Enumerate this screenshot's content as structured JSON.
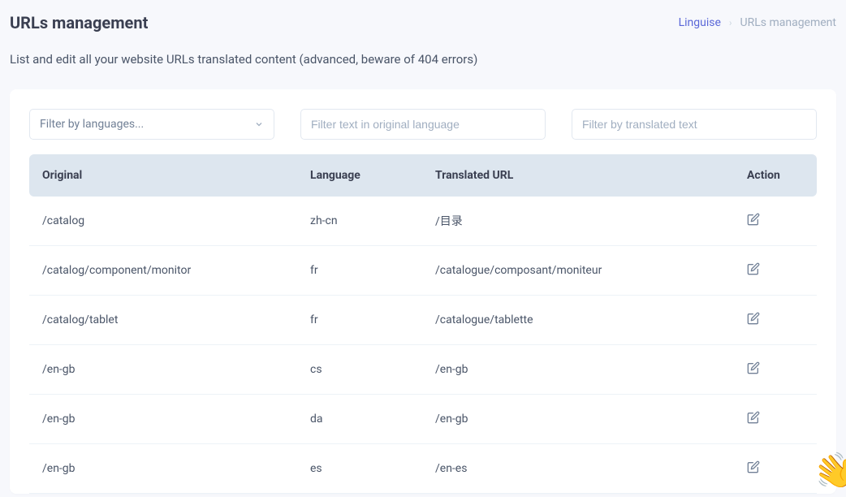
{
  "header": {
    "title": "URLs management",
    "breadcrumb": {
      "home": "Linguise",
      "current": "URLs management"
    }
  },
  "description": "List and edit all your website URLs translated content (advanced, beware of 404 errors)",
  "filters": {
    "language_placeholder": "Filter by languages...",
    "original_placeholder": "Filter text in original language",
    "translated_placeholder": "Filter by translated text"
  },
  "table": {
    "headers": {
      "original": "Original",
      "language": "Language",
      "translated": "Translated URL",
      "action": "Action"
    },
    "rows": [
      {
        "original": "/catalog",
        "language": "zh-cn",
        "translated": "/目录"
      },
      {
        "original": "/catalog/component/monitor",
        "language": "fr",
        "translated": "/catalogue/composant/moniteur"
      },
      {
        "original": "/catalog/tablet",
        "language": "fr",
        "translated": "/catalogue/tablette"
      },
      {
        "original": "/en-gb",
        "language": "cs",
        "translated": "/en-gb"
      },
      {
        "original": "/en-gb",
        "language": "da",
        "translated": "/en-gb"
      },
      {
        "original": "/en-gb",
        "language": "es",
        "translated": "/en-es"
      }
    ]
  }
}
